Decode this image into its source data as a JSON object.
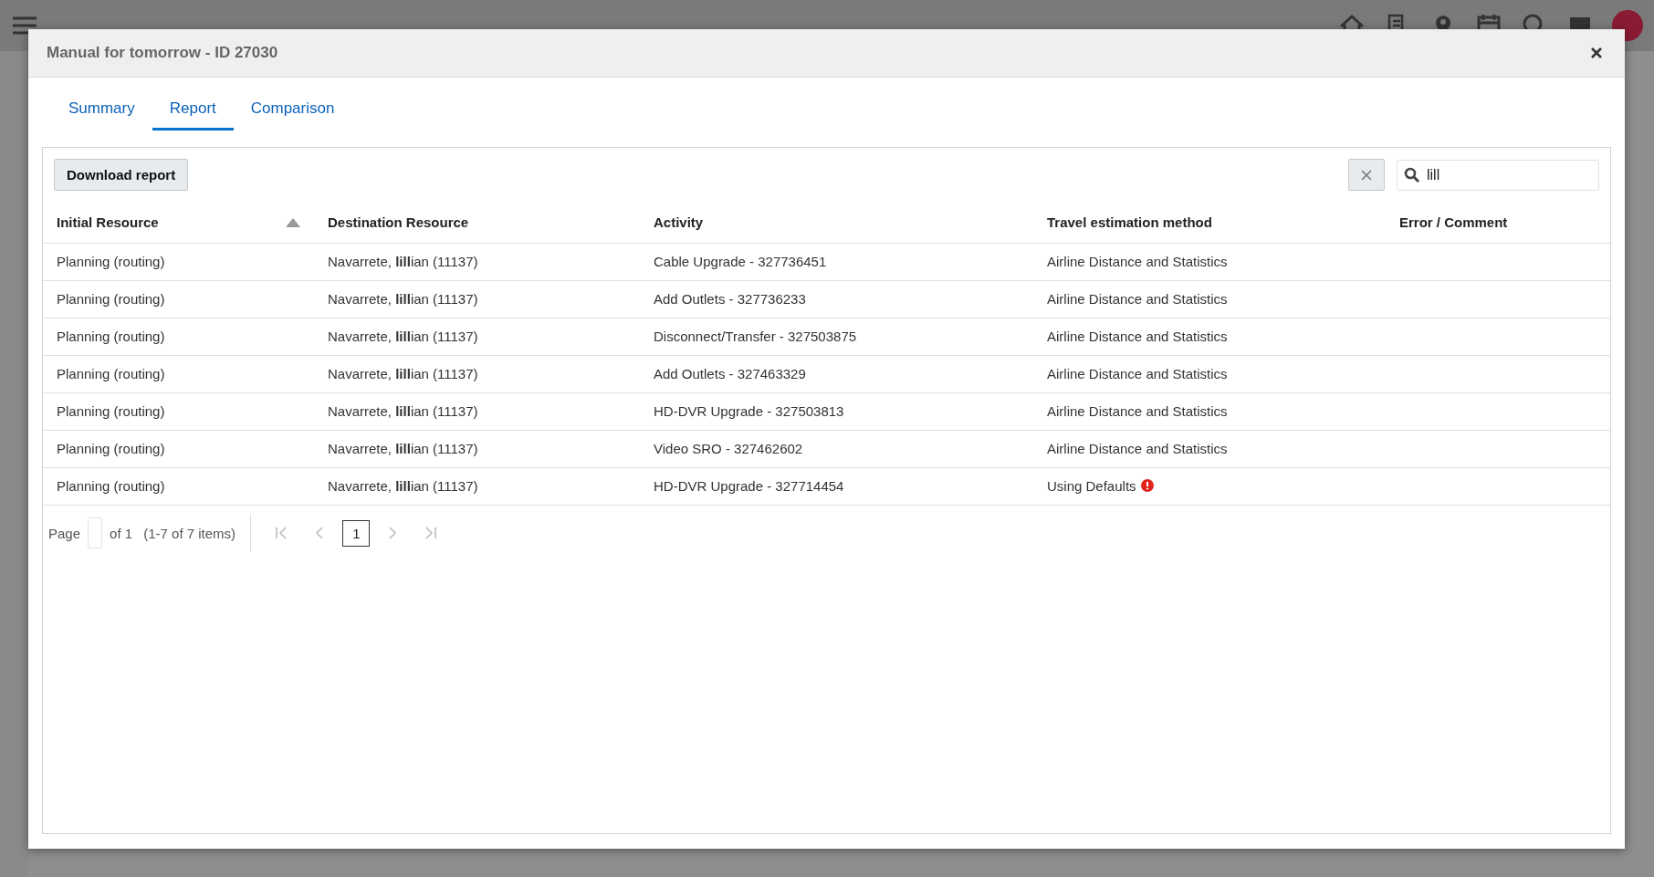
{
  "dialog": {
    "title": "Manual for tomorrow - ID 27030"
  },
  "tabs": [
    {
      "label": "Summary",
      "selected": false
    },
    {
      "label": "Report",
      "selected": true
    },
    {
      "label": "Comparison",
      "selected": false
    }
  ],
  "toolbar": {
    "download_button": "Download report",
    "search": {
      "value": "lill"
    }
  },
  "table": {
    "columns": [
      {
        "label": "Initial Resource",
        "sorted": true
      },
      {
        "label": "Destination Resource",
        "sorted": false
      },
      {
        "label": "Activity",
        "sorted": false
      },
      {
        "label": "Travel estimation method",
        "sorted": false
      },
      {
        "label": "Error / Comment",
        "sorted": false
      }
    ],
    "rows": [
      {
        "initial": "Planning (routing)",
        "destination": "Navarrete, **lill**ian (11137)",
        "activity": "Cable Upgrade - 327736451",
        "travel": "Airline Distance and Statistics",
        "warning": false
      },
      {
        "initial": "Planning (routing)",
        "destination": "Navarrete, **lill**ian (11137)",
        "activity": "Add Outlets - 327736233",
        "travel": "Airline Distance and Statistics",
        "warning": false
      },
      {
        "initial": "Planning (routing)",
        "destination": "Navarrete, **lill**ian (11137)",
        "activity": "Disconnect/Transfer - 327503875",
        "travel": "Airline Distance and Statistics",
        "warning": false
      },
      {
        "initial": "Planning (routing)",
        "destination": "Navarrete, **lill**ian (11137)",
        "activity": "Add Outlets - 327463329",
        "travel": "Airline Distance and Statistics",
        "warning": false
      },
      {
        "initial": "Planning (routing)",
        "destination": "Navarrete, **lill**ian (11137)",
        "activity": "HD-DVR Upgrade - 327503813",
        "travel": "Airline Distance and Statistics",
        "warning": false
      },
      {
        "initial": "Planning (routing)",
        "destination": "Navarrete, **lill**ian (11137)",
        "activity": "Video SRO - 327462602",
        "travel": "Airline Distance and Statistics",
        "warning": false
      },
      {
        "initial": "Planning (routing)",
        "destination": "Navarrete, **lill**ian (11137)",
        "activity": "HD-DVR Upgrade - 327714454",
        "travel": "Using Defaults",
        "warning": true
      }
    ]
  },
  "pagination": {
    "page_label": "Page",
    "of_label": "of 1",
    "items_label": "(1-7 of 7 items)",
    "current_page": "1"
  }
}
